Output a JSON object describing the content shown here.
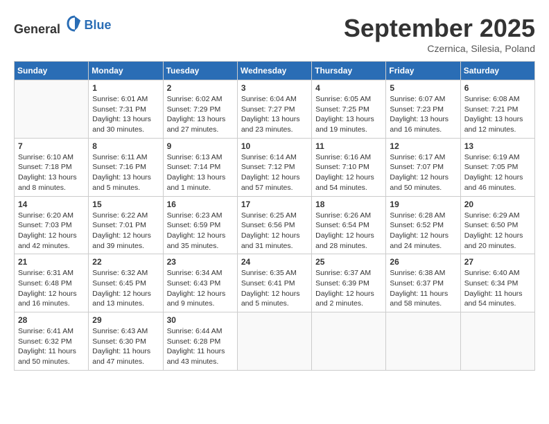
{
  "header": {
    "logo_general": "General",
    "logo_blue": "Blue",
    "month_title": "September 2025",
    "location": "Czernica, Silesia, Poland"
  },
  "weekdays": [
    "Sunday",
    "Monday",
    "Tuesday",
    "Wednesday",
    "Thursday",
    "Friday",
    "Saturday"
  ],
  "weeks": [
    [
      {
        "day": "",
        "info": ""
      },
      {
        "day": "1",
        "info": "Sunrise: 6:01 AM\nSunset: 7:31 PM\nDaylight: 13 hours and 30 minutes."
      },
      {
        "day": "2",
        "info": "Sunrise: 6:02 AM\nSunset: 7:29 PM\nDaylight: 13 hours and 27 minutes."
      },
      {
        "day": "3",
        "info": "Sunrise: 6:04 AM\nSunset: 7:27 PM\nDaylight: 13 hours and 23 minutes."
      },
      {
        "day": "4",
        "info": "Sunrise: 6:05 AM\nSunset: 7:25 PM\nDaylight: 13 hours and 19 minutes."
      },
      {
        "day": "5",
        "info": "Sunrise: 6:07 AM\nSunset: 7:23 PM\nDaylight: 13 hours and 16 minutes."
      },
      {
        "day": "6",
        "info": "Sunrise: 6:08 AM\nSunset: 7:21 PM\nDaylight: 13 hours and 12 minutes."
      }
    ],
    [
      {
        "day": "7",
        "info": "Sunrise: 6:10 AM\nSunset: 7:18 PM\nDaylight: 13 hours and 8 minutes."
      },
      {
        "day": "8",
        "info": "Sunrise: 6:11 AM\nSunset: 7:16 PM\nDaylight: 13 hours and 5 minutes."
      },
      {
        "day": "9",
        "info": "Sunrise: 6:13 AM\nSunset: 7:14 PM\nDaylight: 13 hours and 1 minute."
      },
      {
        "day": "10",
        "info": "Sunrise: 6:14 AM\nSunset: 7:12 PM\nDaylight: 12 hours and 57 minutes."
      },
      {
        "day": "11",
        "info": "Sunrise: 6:16 AM\nSunset: 7:10 PM\nDaylight: 12 hours and 54 minutes."
      },
      {
        "day": "12",
        "info": "Sunrise: 6:17 AM\nSunset: 7:07 PM\nDaylight: 12 hours and 50 minutes."
      },
      {
        "day": "13",
        "info": "Sunrise: 6:19 AM\nSunset: 7:05 PM\nDaylight: 12 hours and 46 minutes."
      }
    ],
    [
      {
        "day": "14",
        "info": "Sunrise: 6:20 AM\nSunset: 7:03 PM\nDaylight: 12 hours and 42 minutes."
      },
      {
        "day": "15",
        "info": "Sunrise: 6:22 AM\nSunset: 7:01 PM\nDaylight: 12 hours and 39 minutes."
      },
      {
        "day": "16",
        "info": "Sunrise: 6:23 AM\nSunset: 6:59 PM\nDaylight: 12 hours and 35 minutes."
      },
      {
        "day": "17",
        "info": "Sunrise: 6:25 AM\nSunset: 6:56 PM\nDaylight: 12 hours and 31 minutes."
      },
      {
        "day": "18",
        "info": "Sunrise: 6:26 AM\nSunset: 6:54 PM\nDaylight: 12 hours and 28 minutes."
      },
      {
        "day": "19",
        "info": "Sunrise: 6:28 AM\nSunset: 6:52 PM\nDaylight: 12 hours and 24 minutes."
      },
      {
        "day": "20",
        "info": "Sunrise: 6:29 AM\nSunset: 6:50 PM\nDaylight: 12 hours and 20 minutes."
      }
    ],
    [
      {
        "day": "21",
        "info": "Sunrise: 6:31 AM\nSunset: 6:48 PM\nDaylight: 12 hours and 16 minutes."
      },
      {
        "day": "22",
        "info": "Sunrise: 6:32 AM\nSunset: 6:45 PM\nDaylight: 12 hours and 13 minutes."
      },
      {
        "day": "23",
        "info": "Sunrise: 6:34 AM\nSunset: 6:43 PM\nDaylight: 12 hours and 9 minutes."
      },
      {
        "day": "24",
        "info": "Sunrise: 6:35 AM\nSunset: 6:41 PM\nDaylight: 12 hours and 5 minutes."
      },
      {
        "day": "25",
        "info": "Sunrise: 6:37 AM\nSunset: 6:39 PM\nDaylight: 12 hours and 2 minutes."
      },
      {
        "day": "26",
        "info": "Sunrise: 6:38 AM\nSunset: 6:37 PM\nDaylight: 11 hours and 58 minutes."
      },
      {
        "day": "27",
        "info": "Sunrise: 6:40 AM\nSunset: 6:34 PM\nDaylight: 11 hours and 54 minutes."
      }
    ],
    [
      {
        "day": "28",
        "info": "Sunrise: 6:41 AM\nSunset: 6:32 PM\nDaylight: 11 hours and 50 minutes."
      },
      {
        "day": "29",
        "info": "Sunrise: 6:43 AM\nSunset: 6:30 PM\nDaylight: 11 hours and 47 minutes."
      },
      {
        "day": "30",
        "info": "Sunrise: 6:44 AM\nSunset: 6:28 PM\nDaylight: 11 hours and 43 minutes."
      },
      {
        "day": "",
        "info": ""
      },
      {
        "day": "",
        "info": ""
      },
      {
        "day": "",
        "info": ""
      },
      {
        "day": "",
        "info": ""
      }
    ]
  ]
}
